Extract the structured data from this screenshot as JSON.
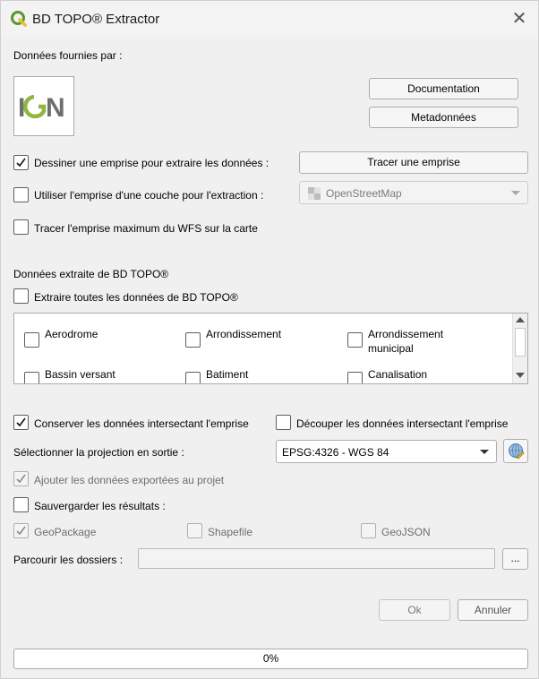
{
  "window": {
    "title": "BD TOPO® Extractor",
    "close_glyph": "✕",
    "app_icon": "qgis-logo-icon"
  },
  "provider": {
    "label": "Données fournies par :",
    "logo_text": "IGN",
    "logo_icon": "ign-logo-icon"
  },
  "buttons": {
    "documentation": "Documentation",
    "metadata": "Metadonnées",
    "trace": "Tracer une emprise",
    "browse": "...",
    "ok": "Ok",
    "cancel": "Annuler"
  },
  "extent": {
    "draw_label": "Dessiner une emprise pour extraire les données :",
    "draw_checked": true,
    "layer_label": "Utiliser l'emprise d'une couche pour l'extraction :",
    "layer_checked": false,
    "layer_combo_value": "OpenStreetMap",
    "wfs_label": "Tracer l'emprise maximum du WFS sur la carte",
    "wfs_checked": false
  },
  "extract": {
    "section_label": "Données extraite de BD TOPO®",
    "all_label": "Extraire toutes les données de BD TOPO®",
    "all_checked": false,
    "items": [
      {
        "line1": "Aerodrome",
        "line2": ""
      },
      {
        "line1": "Arrondissement",
        "line2": ""
      },
      {
        "line1": "Arrondissement",
        "line2": "municipal"
      },
      {
        "line1": "Bassin versant",
        "line2": ""
      },
      {
        "line1": "Batiment",
        "line2": ""
      },
      {
        "line1": "Canalisation",
        "line2": ""
      }
    ]
  },
  "options": {
    "keep_label": "Conserver les données intersectant l'emprise",
    "keep_checked": true,
    "cut_label": "Découper les données intersectant l'emprise",
    "cut_checked": false,
    "projection_label": "Sélectionner la projection en sortie :",
    "projection_value": "EPSG:4326 - WGS 84",
    "projection_icon": "crs-globe-icon",
    "add_label": "Ajouter les données exportées au projet",
    "add_checked": true,
    "save_label": "Sauvergarder les résultats :",
    "save_checked": false
  },
  "formats": {
    "geopackage": "GeoPackage",
    "geopackage_checked": true,
    "shapefile": "Shapefile",
    "shapefile_checked": false,
    "geojson": "GeoJSON",
    "geojson_checked": false
  },
  "browse": {
    "label": "Parcourir les dossiers :",
    "value": ""
  },
  "progress": {
    "text": "0%",
    "value": 0
  },
  "colors": {
    "qgis_green": "#589632",
    "qgis_yellow": "#eebe2f",
    "ign_gray": "#6e6e6e",
    "ign_green": "#8fb63e"
  }
}
